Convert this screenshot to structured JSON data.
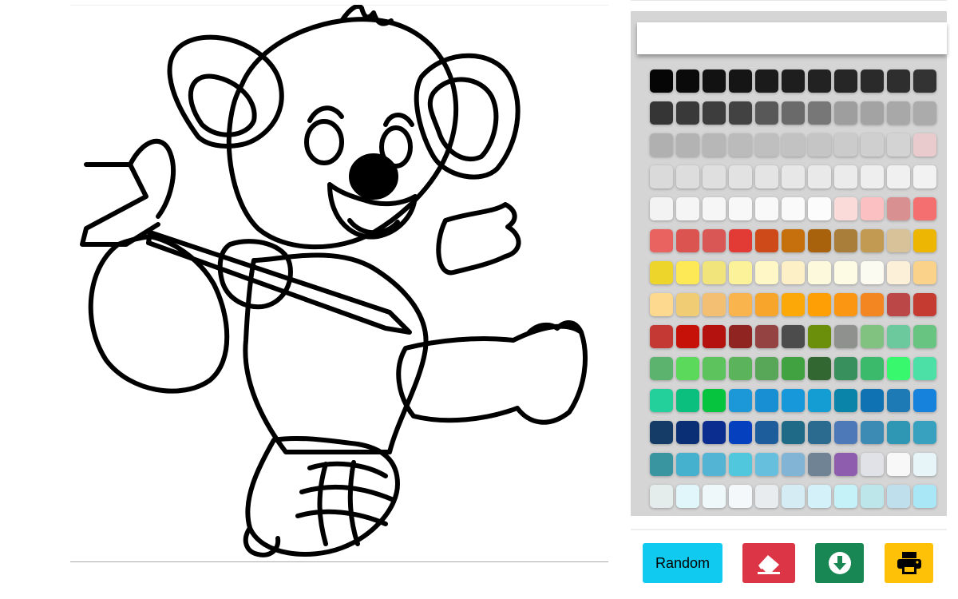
{
  "app": {
    "colors": {
      "random_button": "#11caf0",
      "eraser_button": "#dc3545",
      "download_button": "#198754",
      "print_button": "#ffc107",
      "panel_background": "#d5d5d5"
    }
  },
  "canvas": {
    "image": "koala-coloring-page"
  },
  "palette": {
    "header_text": "",
    "swatches": [
      "#050505",
      "#0a0a0a",
      "#121212",
      "#151515",
      "#1b1b1b",
      "#1e1e1e",
      "#222222",
      "#262626",
      "#2a2a2a",
      "#2e2e2e",
      "#333333",
      "#353535",
      "#393939",
      "#3d3d3d",
      "#424242",
      "#585858",
      "#6a6a6a",
      "#777777",
      "#9e9e9e",
      "#a3a3a3",
      "#a8a8a8",
      "#ababab",
      "#b0b0b0",
      "#b3b3b3",
      "#b7b7b7",
      "#bbbbbb",
      "#bfbfbf",
      "#c2c2c2",
      "#c5c5c5",
      "#cbcbcb",
      "#cfcfcf",
      "#d3d3d3",
      "#eacbcd",
      "#dadada",
      "#dddddd",
      "#dfdfdf",
      "#e2e2e2",
      "#e4e4e4",
      "#e7e7e7",
      "#e9e9e9",
      "#ebebeb",
      "#eeeeee",
      "#f0f0f0",
      "#f2f2f2",
      "#f3f3f3",
      "#f5f5f5",
      "#f6f6f6",
      "#f8f8f8",
      "#f9f9f9",
      "#fafafa",
      "#fcfcfc",
      "#fbdada",
      "#fbc0c1",
      "#d99090",
      "#f47070",
      "#e96360",
      "#dc544f",
      "#d95855",
      "#e23b36",
      "#cf4a19",
      "#c6700d",
      "#a8620b",
      "#a97e3b",
      "#c39a51",
      "#d8c29a",
      "#ecb603",
      "#eed52b",
      "#fde955",
      "#f1e47b",
      "#fcf29a",
      "#fff7c5",
      "#fdf0c6",
      "#fdf9dd",
      "#fdfbe3",
      "#fbfbf2",
      "#fcf0d9",
      "#fbd28a",
      "#fcd98f",
      "#f0cc75",
      "#f2bf73",
      "#f9b44d",
      "#f8a62b",
      "#fca808",
      "#fd9f05",
      "#fb9613",
      "#f38620",
      "#bb4746",
      "#c53b32",
      "#c43933",
      "#c51108",
      "#b3120f",
      "#8f2421",
      "#944242",
      "#4c4c4c",
      "#6b8e0b",
      "#8f918f",
      "#82c281",
      "#6cc99d",
      "#67c481",
      "#5bb36d",
      "#5ad95a",
      "#5dc35d",
      "#5bb35b",
      "#58a657",
      "#41a241",
      "#326731",
      "#38915c",
      "#3aba6a",
      "#38f86d",
      "#4ce0a6",
      "#23cf9a",
      "#0bbf7e",
      "#07c43f",
      "#1c98d9",
      "#178fd2",
      "#1698da",
      "#149dd2",
      "#0a84a8",
      "#0f72b2",
      "#1d7ab5",
      "#1782dc",
      "#143c66",
      "#0b2f75",
      "#0b2d8f",
      "#0541bf",
      "#1e5d9b",
      "#1f6a86",
      "#2a6b8f",
      "#4d79b8",
      "#3b8bb4",
      "#2f96b4",
      "#37a1bf",
      "#3996a0",
      "#46b0cf",
      "#53b4d4",
      "#51c7dd",
      "#66bfdd",
      "#82b5d5",
      "#708395",
      "#8f5dae",
      "#e1e1e8",
      "#f8f8f8",
      "#e7f5f9",
      "#e4ecec",
      "#e1f6fa",
      "#eef7f9",
      "#f4f8fa",
      "#e8ecee",
      "#d6ecf4",
      "#d4f1fa",
      "#c4f2f8",
      "#bce6ea",
      "#c0dfed",
      "#a9e7f7"
    ]
  },
  "toolbar": {
    "random_label": "Random",
    "eraser_icon": "eraser-icon",
    "download_icon": "download-circle-icon",
    "print_icon": "printer-icon"
  }
}
